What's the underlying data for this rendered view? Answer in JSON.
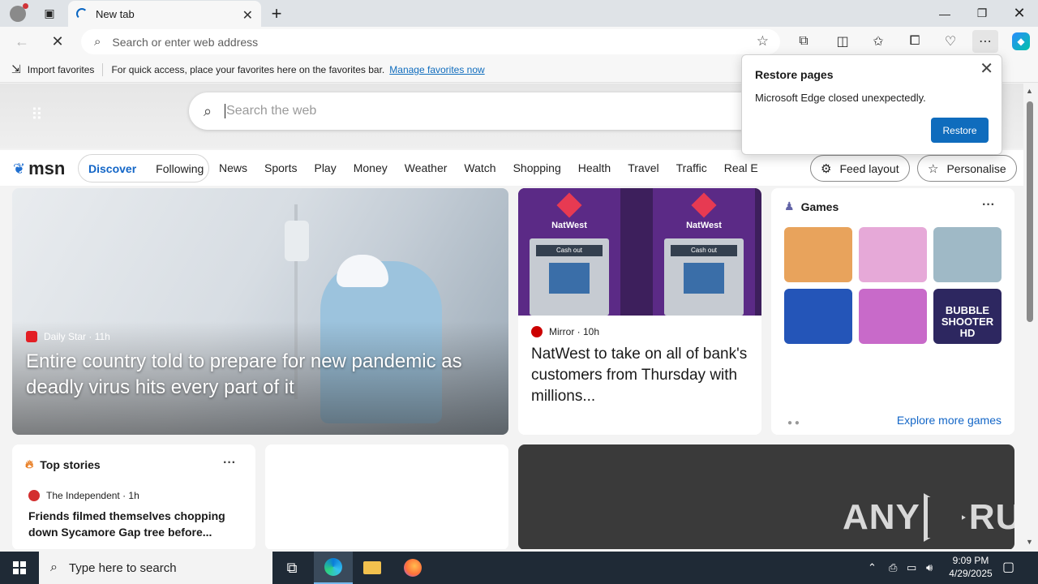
{
  "browser": {
    "tab": {
      "title": "New tab"
    },
    "address": {
      "placeholder": "Search or enter web address"
    },
    "favorites_bar": {
      "import_label": "Import favorites",
      "message": "For quick access, place your favorites here on the favorites bar.",
      "link": "Manage favorites now"
    }
  },
  "popup": {
    "title": "Restore pages",
    "message": "Microsoft Edge closed unexpectedly.",
    "button": "Restore"
  },
  "newtab": {
    "search_placeholder": "Search the web",
    "logo_text": "msn",
    "feed_tabs": [
      "Discover",
      "Following"
    ],
    "nav_links": [
      "News",
      "Sports",
      "Play",
      "Money",
      "Weather",
      "Watch",
      "Shopping",
      "Health",
      "Travel",
      "Traffic",
      "Real E"
    ],
    "feed_layout": "Feed layout",
    "personalise": "Personalise"
  },
  "hero": {
    "source": "Daily Star",
    "age": "11h",
    "headline": "Entire country told to prepare for new pandemic as deadly virus hits every part of it"
  },
  "natwest": {
    "brand": "NatWest",
    "atm_label": "Cash out",
    "source": "Mirror",
    "age": "10h",
    "headline": "NatWest to take on all of bank's customers from Thursday with millions..."
  },
  "games": {
    "title": "Games",
    "tiles": [
      {
        "label": "",
        "color": "#e8a35c"
      },
      {
        "label": "",
        "color": "#e6a9d8"
      },
      {
        "label": "",
        "color": "#9fb9c6"
      },
      {
        "label": "",
        "color": "#2455b8"
      },
      {
        "label": "",
        "color": "#c86ac9"
      },
      {
        "label": "BUBBLE SHOOTER HD",
        "color": "#2d2760"
      }
    ],
    "explore": "Explore more games"
  },
  "top_stories": {
    "title": "Top stories",
    "source": "The Independent",
    "age": "1h",
    "headline": "Friends filmed themselves chopping down Sycamore Gap tree before..."
  },
  "watermark": {
    "left": "ANY",
    "right": "RUN"
  },
  "taskbar": {
    "search_placeholder": "Type here to search",
    "time": "9:09 PM",
    "date": "4/29/2025"
  }
}
